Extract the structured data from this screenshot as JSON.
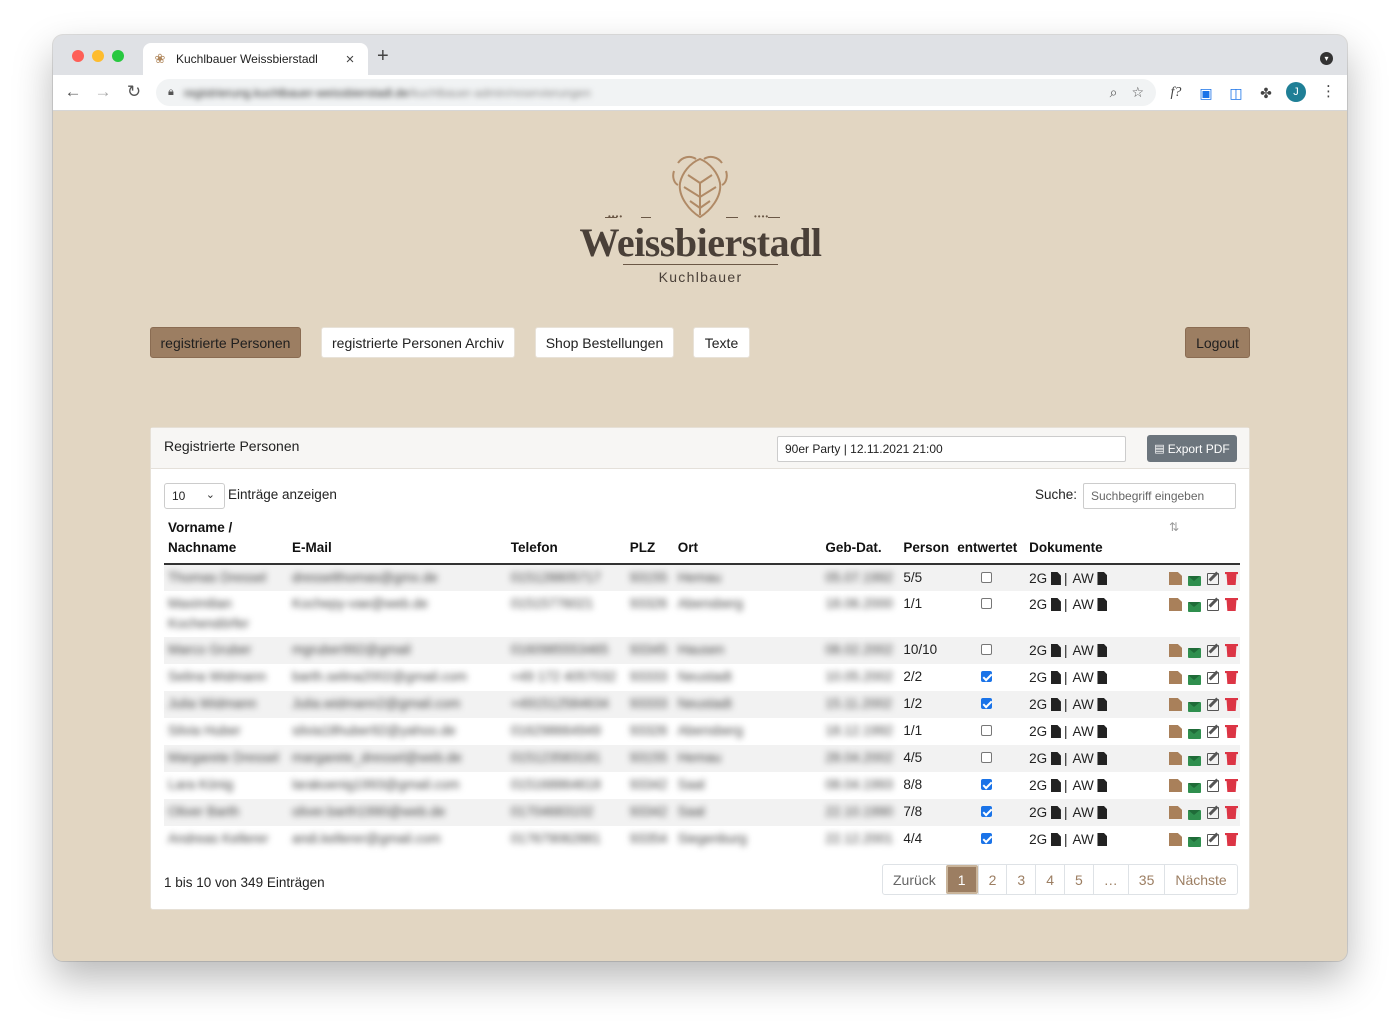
{
  "browser": {
    "tab_title": "Kuchlbauer Weissbierstadl",
    "tab_close": "×",
    "new_tab": "+",
    "url_host": "registrierung.kuchlbauer-weissbierstadl.de",
    "url_path": "/kuchlbauer-admin/reservierungen",
    "profile_initial": "J",
    "extension_fx_label": "f?"
  },
  "logo": {
    "brand": "Weissbierstadl",
    "sub": "Kuchlbauer",
    "dots_left": "••••",
    "dots_right": "••••"
  },
  "nav": {
    "items": [
      {
        "label": "registrierte Personen",
        "active": true
      },
      {
        "label": "registrierte Personen Archiv",
        "active": false
      },
      {
        "label": "Shop Bestellungen",
        "active": false
      },
      {
        "label": "Texte",
        "active": false
      }
    ],
    "logout_label": "Logout"
  },
  "card": {
    "title": "Registrierte Personen",
    "event_value": "90er Party | 12.11.2021 21:00",
    "export_label": "Export PDF",
    "page_length_value": "10",
    "page_length_label": "Einträge anzeigen",
    "search_label": "Suche:",
    "search_placeholder": "Suchbegriff eingeben",
    "columns": {
      "name_line1": "Vorname /",
      "name_line2": "Nachname",
      "email": "E-Mail",
      "phone": "Telefon",
      "zip": "PLZ",
      "city": "Ort",
      "birth": "Geb-Dat.",
      "persons": "Person",
      "validated": "entwertet",
      "documents": "Dokumente"
    },
    "doc_labels": {
      "g2": "2G",
      "sep": "|",
      "aw": "AW"
    },
    "rows": [
      {
        "name": "Thomas Dressel",
        "email": "dresselthomas@gmx.de",
        "phone": "015128805717",
        "zip": "93155",
        "city": "Hemau",
        "birth": "05.07.1992",
        "persons": "5/5",
        "validated": false
      },
      {
        "name": "Maximilian Kochendörfer",
        "email": "Kochepy-vae@web.de",
        "phone": "01515776021",
        "zip": "93326",
        "city": "Abensberg",
        "birth": "18.06.2000",
        "persons": "1/1",
        "validated": false
      },
      {
        "name": "Marco Gruber",
        "email": "mgruber992@gmail",
        "phone": "0160985553465",
        "zip": "93345",
        "city": "Hausen",
        "birth": "08.02.2002",
        "persons": "10/10",
        "validated": false
      },
      {
        "name": "Selina Widmann",
        "email": "barth.selina2002@gmail.com",
        "phone": "+49 172 4057032",
        "zip": "93333",
        "city": "Neustadt",
        "birth": "10.05.2002",
        "persons": "2/2",
        "validated": true
      },
      {
        "name": "Julia Widmann",
        "email": "Julia.widmann2@gmail.com",
        "phone": "+491512584634",
        "zip": "93333",
        "city": "Neustadt",
        "birth": "15.11.2002",
        "persons": "1/2",
        "validated": true
      },
      {
        "name": "Silvia Huber",
        "email": "silvia18huber92@yahoo.de",
        "phone": "016298664949",
        "zip": "93326",
        "city": "Abensberg",
        "birth": "18.12.1992",
        "persons": "1/1",
        "validated": false
      },
      {
        "name": "Margarete Dressel",
        "email": "margarete_dressel@web.de",
        "phone": "015123583181",
        "zip": "93155",
        "city": "Hemau",
        "birth": "28.04.2002",
        "persons": "4/5",
        "validated": false
      },
      {
        "name": "Lara König",
        "email": "larakoenig1993@gmail.com",
        "phone": "015168864618",
        "zip": "93342",
        "city": "Saal",
        "birth": "08.04.1993",
        "persons": "8/8",
        "validated": true
      },
      {
        "name": "Oliver Barth",
        "email": "oliver.barth1990@web.de",
        "phone": "01704683102",
        "zip": "93342",
        "city": "Saal",
        "birth": "22.10.1990",
        "persons": "7/8",
        "validated": true
      },
      {
        "name": "Andreas Kellerer",
        "email": "andi.kellerer@gmail.com",
        "phone": "017679062881",
        "zip": "93354",
        "city": "Siegenburg",
        "birth": "22.12.2001",
        "persons": "4/4",
        "validated": true
      }
    ],
    "info": "1 bis 10 von 349 Einträgen",
    "pagination": [
      "Zurück",
      "1",
      "2",
      "3",
      "4",
      "5",
      "…",
      "35",
      "Nächste"
    ],
    "current_page": "1"
  },
  "colors": {
    "page_bg": "#e2d6c2",
    "accent": "#9c7e62",
    "pdf_icon": "#a9805a",
    "mail_icon": "#2f8f4e",
    "delete_icon": "#dc3545",
    "checkbox_on": "#1a73e8"
  },
  "icons": {
    "row_actions": [
      "file-pdf-icon",
      "envelope-icon",
      "edit-icon",
      "trash-icon"
    ],
    "document": "file-icon",
    "export": "file-pdf-icon",
    "sort": "sort-icon"
  }
}
